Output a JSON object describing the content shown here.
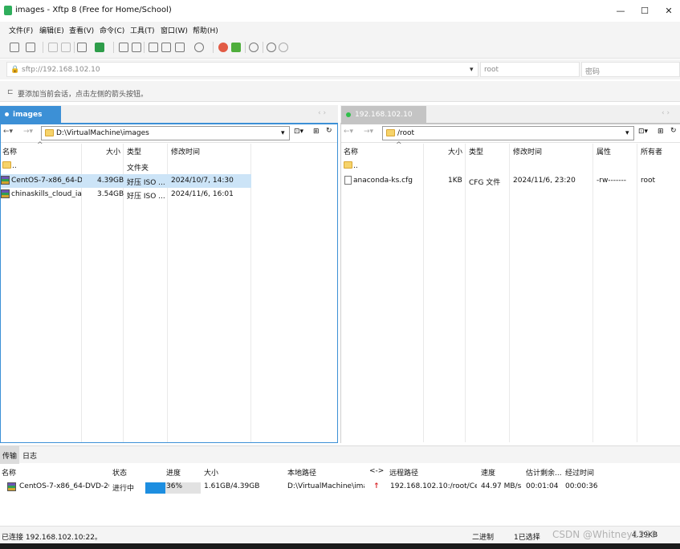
{
  "window": {
    "title": "images - Xftp 8 (Free for Home/School)",
    "minimize": "—",
    "maximize": "☐",
    "close": "✕"
  },
  "menu": [
    "文件(F)",
    "编辑(E)",
    "查看(V)",
    "命令(C)",
    "工具(T)",
    "窗口(W)",
    "帮助(H)"
  ],
  "address": {
    "url": "sftp://192.168.102.10",
    "user_placeholder": "root",
    "password_placeholder": "密码"
  },
  "hint": "要添加当前会话，点击左侧的箭头按钮。",
  "local": {
    "tab": "images",
    "path": "D:\\VirtualMachine\\images",
    "columns": [
      "名称",
      "大小",
      "类型",
      "修改时间"
    ],
    "rows": [
      {
        "name": "..",
        "size": "",
        "type": "文件夹",
        "modified": ""
      },
      {
        "name": "CentOS-7-x86_64-D...",
        "size": "4.39GB",
        "type": "好压 ISO ...",
        "modified": "2024/10/7, 14:30"
      },
      {
        "name": "chinaskills_cloud_ia...",
        "size": "3.54GB",
        "type": "好压 ISO ...",
        "modified": "2024/11/6, 16:01"
      }
    ]
  },
  "remote": {
    "tab": "192.168.102.10",
    "path": "/root",
    "columns": [
      "名称",
      "大小",
      "类型",
      "修改时间",
      "属性",
      "所有者"
    ],
    "rows": [
      {
        "name": "..",
        "size": "",
        "type": "",
        "modified": "",
        "attr": "",
        "owner": ""
      },
      {
        "name": "anaconda-ks.cfg",
        "size": "1KB",
        "type": "CFG 文件",
        "modified": "2024/11/6, 23:20",
        "attr": "-rw-------",
        "owner": "root"
      }
    ]
  },
  "bottom_tabs": [
    "传输",
    "日志"
  ],
  "transfers": {
    "columns": [
      "名称",
      "状态",
      "进度",
      "大小",
      "本地路径",
      "<->",
      "远程路径",
      "速度",
      "估计剩余...",
      "经过时间"
    ],
    "rows": [
      {
        "name": "CentOS-7-x86_64-DVD-20...",
        "status": "进行中",
        "progress_label": "36%",
        "progress": 0.36,
        "size": "1.61GB/4.39GB",
        "local": "D:\\VirtualMachine\\ima...",
        "direction": "↑",
        "remote": "192.168.102.10:/root/Cen...",
        "speed": "44.97 MB/s",
        "remaining": "00:01:04",
        "elapsed": "00:00:36"
      }
    ]
  },
  "status": {
    "left": "已连接 192.168.102.10:22。",
    "mode": "二进制",
    "selected": "1已选择",
    "size": "4.39KB",
    "watermark": "CSDN @Whitney1229"
  },
  "colors": {
    "accent": "#3c90d6",
    "progress": "#1d8ee0",
    "upload_arrow": "#d9262a"
  }
}
